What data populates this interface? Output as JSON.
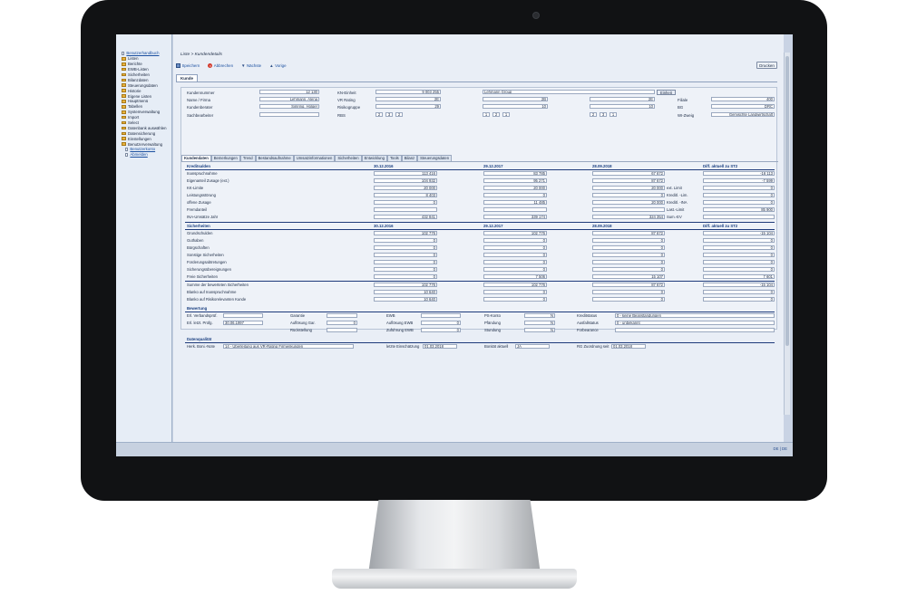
{
  "sidebar": {
    "items": [
      {
        "label": "Benutzerhandbuch",
        "type": "link"
      },
      {
        "label": "Listen",
        "type": "folder"
      },
      {
        "label": "Berichte",
        "type": "folder"
      },
      {
        "label": "EWB-Listen",
        "type": "folder"
      },
      {
        "label": "Sicherheiten",
        "type": "folder"
      },
      {
        "label": "Bilanzdaten",
        "type": "folder"
      },
      {
        "label": "Steuerungsdaten",
        "type": "folder"
      },
      {
        "label": "Historie",
        "type": "folder"
      },
      {
        "label": "Eigene Listen",
        "type": "folder"
      },
      {
        "label": "Hauptmenü",
        "type": "folder"
      },
      {
        "label": "Tabellen",
        "type": "folder"
      },
      {
        "label": "Systemverwaltung",
        "type": "folder"
      },
      {
        "label": "Import",
        "type": "folder"
      },
      {
        "label": "Select",
        "type": "folder"
      },
      {
        "label": "Datenbank auswählen",
        "type": "folder"
      },
      {
        "label": "Datensicherung",
        "type": "folder"
      },
      {
        "label": "Einstellungen",
        "type": "folder"
      },
      {
        "label": "Benutzerverwaltung",
        "type": "folder"
      },
      {
        "label": "Benutzerkonto",
        "type": "sub"
      },
      {
        "label": "Abmelden",
        "type": "sub"
      }
    ]
  },
  "breadcrumb": "Liste > Kundendetails",
  "toolbar": {
    "save": "Speichern",
    "cancel": "Abbrechen",
    "next": "Nächste",
    "prev": "Vorige",
    "print": "Drucken"
  },
  "main_tab": "Kunde",
  "customer": {
    "nr_label": "Kundennummer",
    "nr": "12 130",
    "name_label": "Name / Firma",
    "name": "Lehmann, Alena",
    "advisor_label": "Kundenberater",
    "advisor": "Simring, Holger",
    "clerk_label": "Sachbearbeiter",
    "clerk": "",
    "kn_label": "KN-Einheit",
    "kn": "9 003 255",
    "kn_name": "Lehmann Group",
    "kn_button": "Einheit",
    "vr_label": "VR Rating",
    "vr": [
      "2E",
      "2B",
      "2E"
    ],
    "risk_label": "Risikogruppe",
    "risk": [
      "29",
      "10",
      "10"
    ],
    "rbs_label": "RBS",
    "rbs": [
      [
        "2",
        "3",
        "2"
      ],
      [
        "1",
        "2",
        "1"
      ],
      [
        "2",
        "3",
        "1"
      ]
    ],
    "branch_label": "Filiale",
    "branch": "400",
    "bg_label": "BG",
    "bg": "DRC",
    "wi_label": "WI-Zweig",
    "wi": "Gemischte Landwirtschaft"
  },
  "subtabs": [
    "Kundendaten",
    "Bemerkungen",
    "Trend",
    "Bestandsaufnahme",
    "Umsatzinformationen",
    "Sicherheiten",
    "Entwicklung",
    "Tools",
    "Bilanz",
    "Steuerungsdaten"
  ],
  "credit": {
    "title": "Kreditsalden",
    "dates": [
      "30.12.2016",
      "29.12.2017",
      "28.09.2018"
    ],
    "diff_title": "Diff. aktuell zu ST2",
    "rows": [
      {
        "label": "Inanspruchnahme",
        "v": [
          "113 416",
          "83 785",
          "67 672"
        ],
        "d": "-16 113"
      },
      {
        "label": "Eigenanteil Zusage (ext.)",
        "v": [
          "104 932",
          "95 271",
          "87 672"
        ],
        "d": "-7 599"
      },
      {
        "label": "KK-Limite",
        "v": [
          "20 000",
          "20 000",
          "20 000"
        ],
        "d": "0",
        "side": "ext. Limit"
      },
      {
        "label": "Leistungsstörung",
        "v": [
          "8 403",
          "0",
          "0"
        ],
        "d": "0",
        "side": "Kreditl. -Lim."
      },
      {
        "label": "offene Zusage",
        "v": [
          "0",
          "11 485",
          "20 000"
        ],
        "d": "0",
        "side": "Kreditl. -INA"
      },
      {
        "label": "Fremdanteil",
        "v": [
          "",
          "",
          ""
        ],
        "d": "85 900",
        "side": "Last.-Limit"
      },
      {
        "label": "INA-Umsätze Jahr",
        "v": [
          "432 841",
          "339 174",
          "324 354"
        ],
        "d": "",
        "side": "Sum.-EV"
      }
    ]
  },
  "security": {
    "title": "Sicherheiten",
    "dates": [
      "30.12.2016",
      "29.12.2017",
      "28.09.2018"
    ],
    "diff_title": "Diff. aktuell zu ST2",
    "rows": [
      {
        "label": "Grundschulden",
        "v": [
          "102 776",
          "102 776",
          "87 672"
        ],
        "d": "-15 104"
      },
      {
        "label": "Guthaben",
        "v": [
          "0",
          "0",
          "0"
        ],
        "d": "0"
      },
      {
        "label": "Bürgschaften",
        "v": [
          "0",
          "0",
          "0"
        ],
        "d": "0"
      },
      {
        "label": "Sonstige Sicherheiten",
        "v": [
          "0",
          "0",
          "0"
        ],
        "d": "0"
      },
      {
        "label": "Forderungsabtretungen",
        "v": [
          "0",
          "0",
          "0"
        ],
        "d": "0"
      },
      {
        "label": "Sicherungsübereignungen",
        "v": [
          "0",
          "0",
          "0"
        ],
        "d": "0"
      },
      {
        "label": "Freie Sicherheiten",
        "v": [
          "0",
          "7 506",
          "15 107"
        ],
        "d": "7 601"
      }
    ],
    "sum_rows": [
      {
        "label": "Summe der bewerteten Sicherheiten",
        "v": [
          "102 776",
          "102 776",
          "87 672"
        ],
        "d": "-15 104"
      },
      {
        "label": "Blanko auf Inanspruchnahme",
        "v": [
          "10 640",
          "0",
          "0"
        ],
        "d": "0"
      },
      {
        "label": "Blanko auf Risikorelevanten Kunde",
        "v": [
          "10 640",
          "0",
          "0"
        ],
        "d": "0"
      }
    ]
  },
  "rating": {
    "title": "Bewertung",
    "verband_label": "Erl. Verbandsprüf.",
    "verband": "",
    "pruef_label": "Erl. letzt. Prüfg.",
    "pruef": "30.06.1997",
    "garantie_label": "Garantie",
    "garantie": "",
    "aufloesung_label": "Auflösung Gar.",
    "aufloesung": "0",
    "rueck_label": "Rückstellung",
    "rueck": "",
    "ewb_label": "EWB",
    "ewb": "",
    "aufl_ewb_label": "Auflösung EWB",
    "aufl_ewb": "0",
    "zuf_ewb_label": "Zuführung EWB",
    "zuf_ewb": "0",
    "ps_label": "PS-Konto",
    "ps": "N",
    "pfand_label": "Pfändung",
    "pfand": "N",
    "stund_label": "Stundung",
    "stund": "N",
    "kredit_label": "Kreditstatus",
    "kredit": "0 - keine Beanstandungen",
    "ausfall_label": "Ausfallstatus",
    "ausfall": "0 - unbekannt",
    "forb_label": "Forbearance",
    "forb": ""
  },
  "quality": {
    "title": "Datenqualität",
    "bonnote_label": "Herk. Boni.-Note",
    "bonnote": "14 - Überleitung aus VR-Rating Firmenkunden",
    "einsch_label": "letzte Einschätzung",
    "einsch": "01.03.2018",
    "bon_label": "Bonität aktuell",
    "bon": "JA",
    "rg_label": "RG Zuordnung seit",
    "rg": "01.03.2018"
  },
  "status_right": "DE | DE"
}
